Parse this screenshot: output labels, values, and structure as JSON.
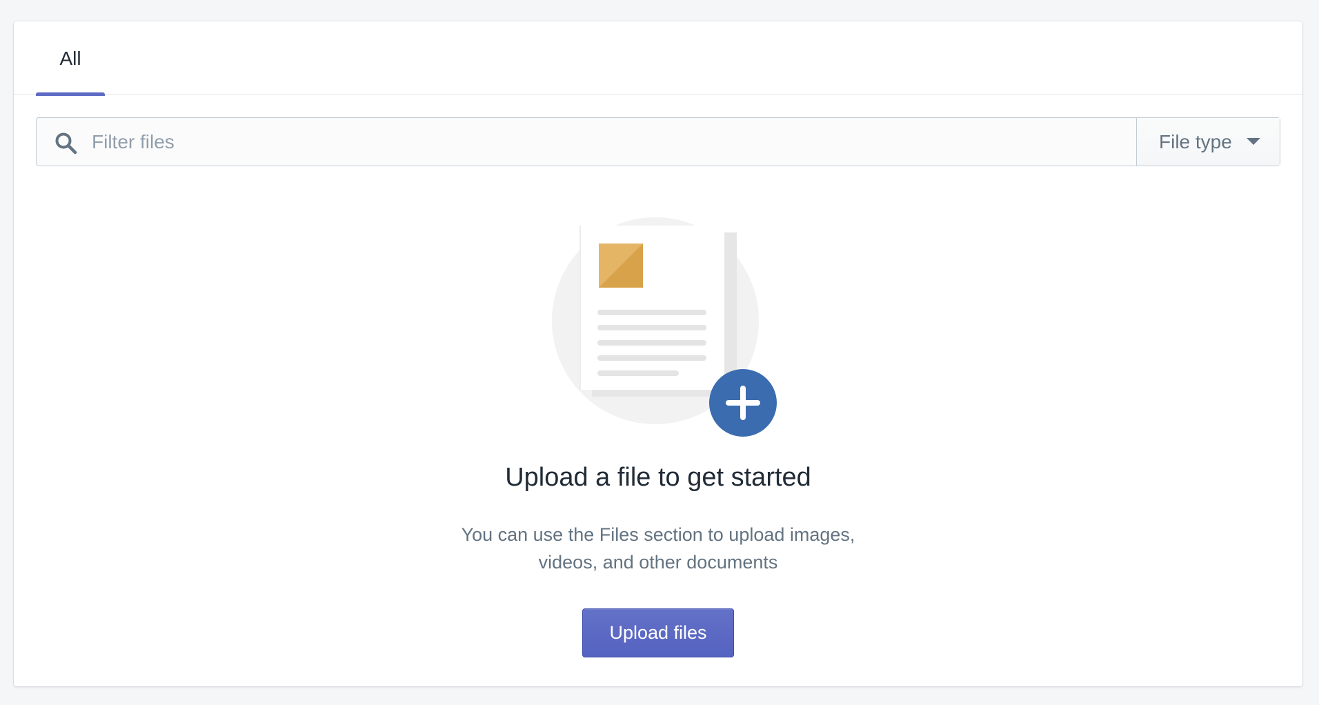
{
  "tabs": [
    {
      "label": "All",
      "selected": true
    }
  ],
  "filter": {
    "search_placeholder": "Filter files",
    "search_value": "",
    "file_type_label": "File type"
  },
  "empty_state": {
    "title": "Upload a file to get started",
    "description": "You can use the Files section to upload images, videos, and other documents",
    "upload_button_label": "Upload files",
    "illustration_icon": "document-add-icon"
  },
  "colors": {
    "accent": "#5c6ac4",
    "button": "#5c6ac4",
    "title_text": "#212b36",
    "muted_text": "#637381",
    "plus_circle": "#3b6cb0",
    "image_thumb": "#d8a24a"
  }
}
